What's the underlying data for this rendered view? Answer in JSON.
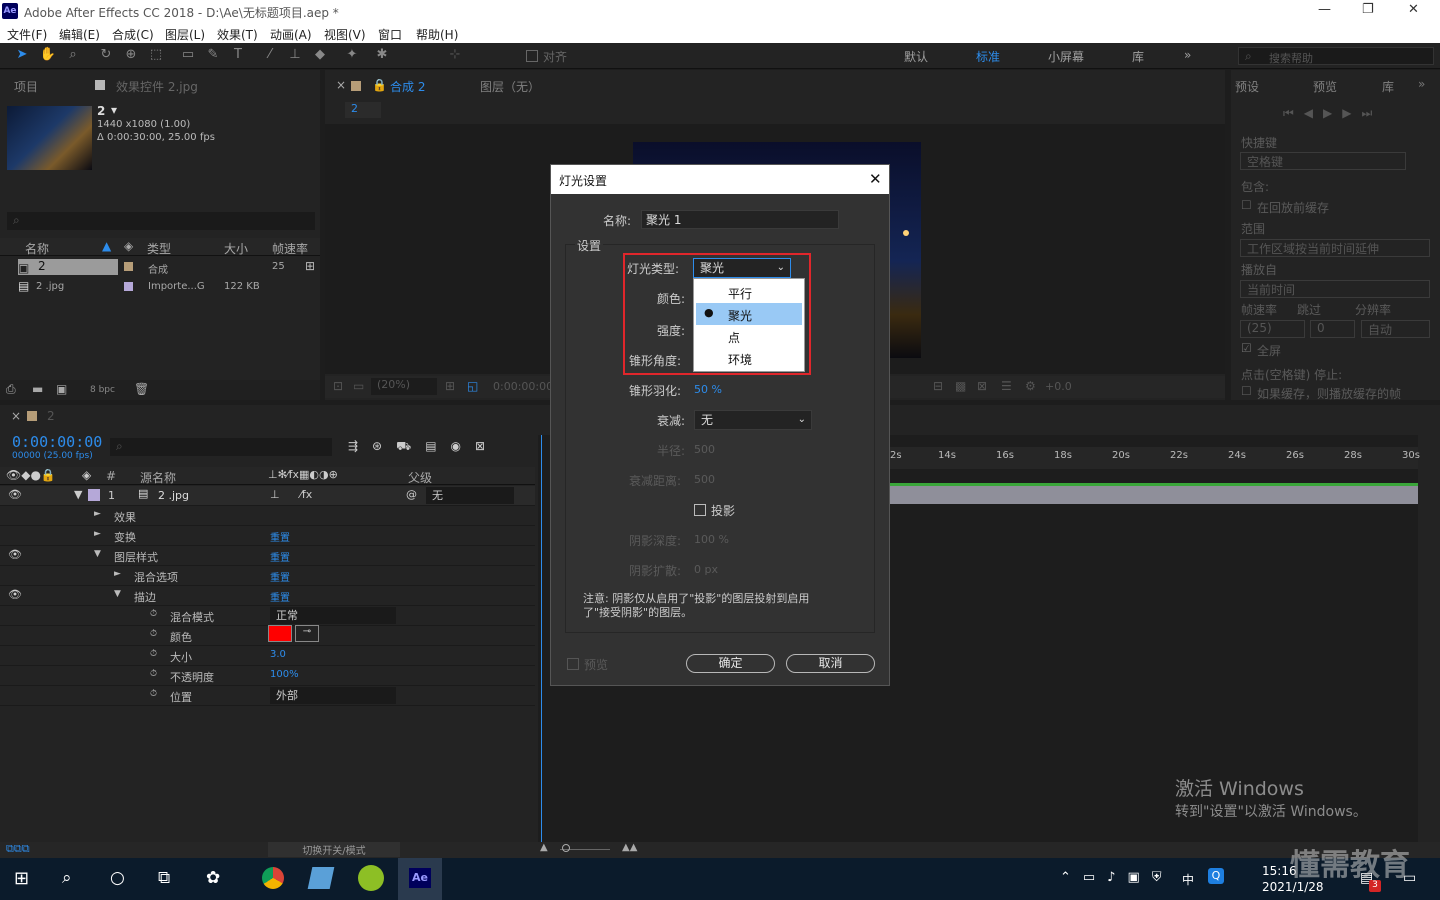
{
  "app": {
    "title": "Adobe After Effects CC 2018 - D:\\Ae\\无标题项目.aep *",
    "logo": "Ae"
  },
  "menu": [
    "文件(F)",
    "编辑(E)",
    "合成(C)",
    "图层(L)",
    "效果(T)",
    "动画(A)",
    "视图(V)",
    "窗口",
    "帮助(H)"
  ],
  "toolbar": {
    "align_label": "对齐",
    "workspaces": [
      "默认",
      "标准",
      "小屏幕",
      "库"
    ],
    "search_placeholder": "搜索帮助"
  },
  "project": {
    "tab_project": "项目",
    "tab_effects": "效果控件 2.jpg",
    "comp_name": "2",
    "comp_info1": "1440 x1080 (1.00)",
    "comp_info2": "Δ 0:00:30:00, 25.00 fps",
    "columns": [
      "名称",
      "类型",
      "大小",
      "帧速率"
    ],
    "rows": [
      {
        "name": "2",
        "type": "合成",
        "size": "",
        "fps": "25"
      },
      {
        "name": "2 .jpg",
        "type": "Importe...G",
        "size": "122 KB",
        "fps": ""
      }
    ],
    "bpc": "8 bpc"
  },
  "comp": {
    "tab_label": "合成 2",
    "layer_tab": "图层（无）",
    "crumb": "2",
    "zoom": "(20%)",
    "time": "0:00:00:00",
    "exposure": "+0.0"
  },
  "right": {
    "tab1": "预设",
    "tab2": "预览",
    "tab3": "库",
    "shortcut_label": "快捷键",
    "shortcut_value": "空格键",
    "include_label": "包含:",
    "cache_label": "在回放前缓存",
    "range_label": "范围",
    "range_value": "工作区域按当前时间延伸",
    "play_from_label": "播放自",
    "play_from_value": "当前时间",
    "fps_label": "帧速率",
    "skip_label": "跳过",
    "res_label": "分辨率",
    "fps_value": "(25)",
    "skip_value": "0",
    "res_value": "自动",
    "fullscreen_label": "全屏",
    "stop_label": "点击(空格键) 停止:",
    "cache_stop_label": "如果缓存，则播放缓存的帧"
  },
  "timeline": {
    "tab": "2",
    "timecode": "0:00:00:00",
    "frames": "00000 (25.00 fps)",
    "col_source": "源名称",
    "col_parent": "父级",
    "layer_num": "1",
    "layer_name": "2 .jpg",
    "parent_value": "无",
    "props": [
      {
        "label": "效果",
        "value": ""
      },
      {
        "label": "变换",
        "value": "重置"
      },
      {
        "label": "图层样式",
        "value": "重置"
      },
      {
        "label": "混合选项",
        "value": "重置"
      },
      {
        "label": "描边",
        "value": "重置"
      },
      {
        "label": "混合模式",
        "value": "正常"
      },
      {
        "label": "颜色",
        "value": ""
      },
      {
        "label": "大小",
        "value": "3.0"
      },
      {
        "label": "不透明度",
        "value": "100%"
      },
      {
        "label": "位置",
        "value": "外部"
      }
    ],
    "ruler": [
      "2s",
      "14s",
      "16s",
      "18s",
      "20s",
      "22s",
      "24s",
      "26s",
      "28s",
      "30s"
    ],
    "switch_label": "切换开关/模式",
    "stroke_color": "#ff0000"
  },
  "dialog": {
    "title": "灯光设置",
    "name_label": "名称:",
    "name_value": "聚光 1",
    "settings_label": "设置",
    "type_label": "灯光类型:",
    "type_value": "聚光",
    "color_label": "颜色:",
    "intensity_label": "强度:",
    "cone_angle_label": "锥形角度:",
    "options": [
      "平行",
      "聚光",
      "点",
      "环境"
    ],
    "selected_option": "聚光",
    "feather_label": "锥形羽化:",
    "feather_value": "50 %",
    "falloff_label": "衰减:",
    "falloff_value": "无",
    "radius_label": "半径:",
    "radius_value": "500",
    "falloff_dist_label": "衰减距离:",
    "falloff_dist_value": "500",
    "shadow_label": "投影",
    "shadow_dark_label": "阴影深度:",
    "shadow_dark_value": "100 %",
    "shadow_diff_label": "阴影扩散:",
    "shadow_diff_value": "0 px",
    "note1": "注意: 阴影仅从启用了\"投影\"的图层投射到启用",
    "note2": "了\"接受阴影\"的图层。",
    "preview_label": "预览",
    "ok_label": "确定",
    "cancel_label": "取消",
    "highlight_color": "#e0262b"
  },
  "watermark": {
    "line1": "激活 Windows",
    "line2": "转到\"设置\"以激活 Windows。",
    "brand": "懂需教育"
  },
  "taskbar": {
    "time": "15:16",
    "date": "2021/1/28",
    "ime": "中",
    "badge": "3"
  }
}
